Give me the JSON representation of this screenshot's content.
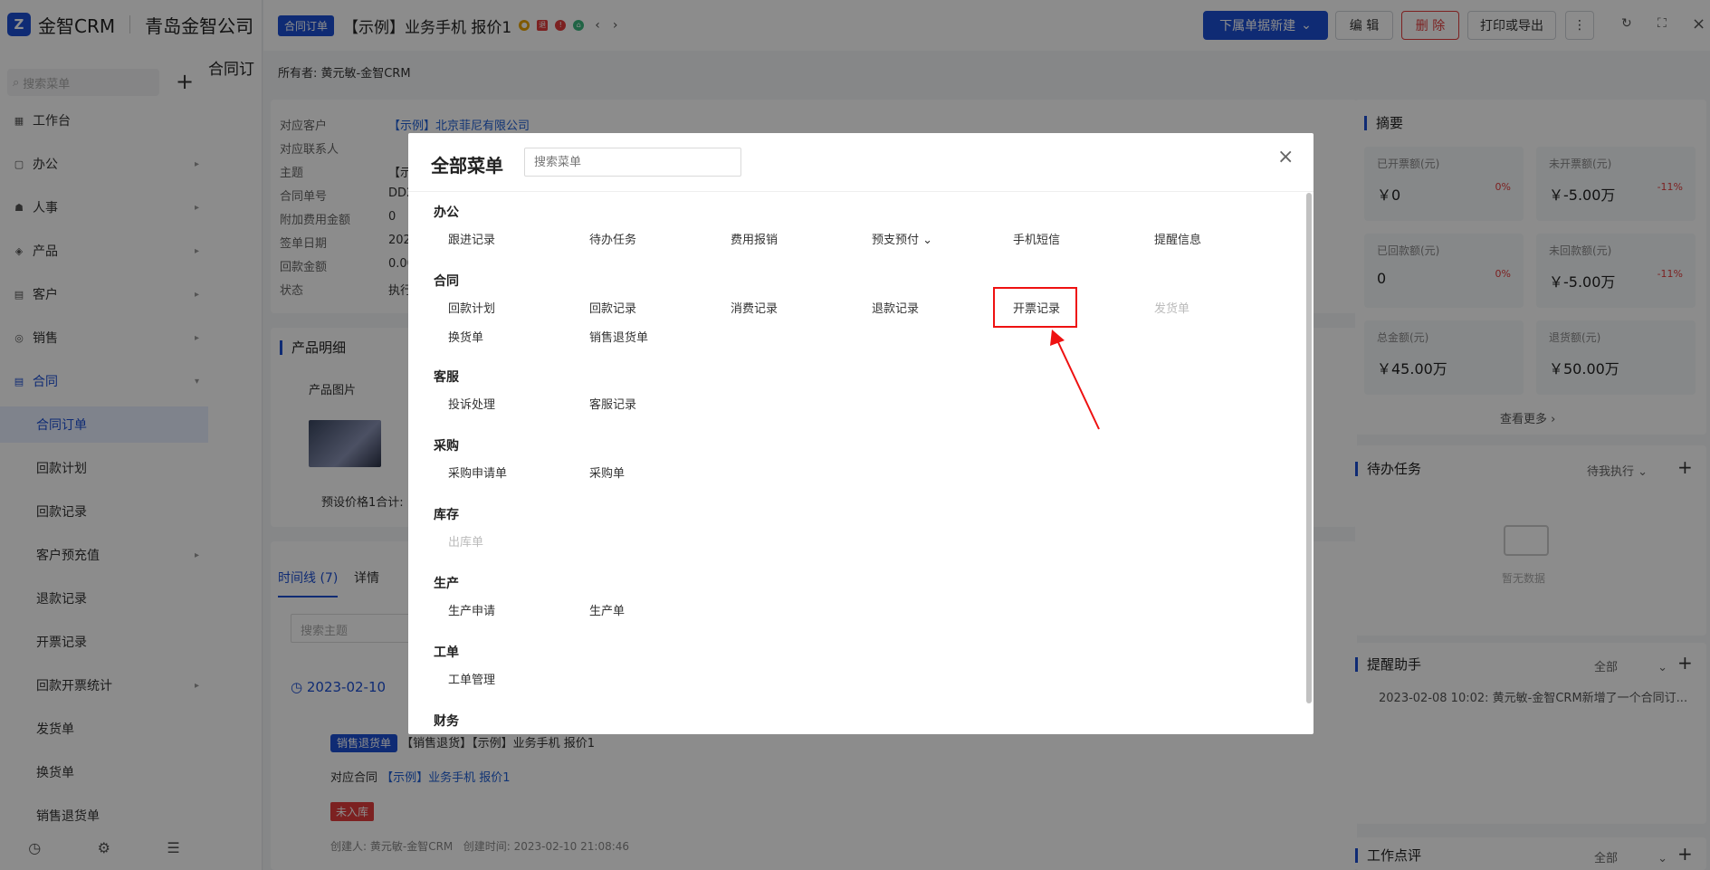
{
  "sidebar": {
    "logo_mark": "Z",
    "brand": "金智CRM",
    "company": "青岛金智公司",
    "search_placeholder": "搜索菜单",
    "plus": "+",
    "items": [
      {
        "label": "工作台",
        "icon": "▦"
      },
      {
        "label": "办公",
        "icon": "▢"
      },
      {
        "label": "人事",
        "icon": "☗"
      },
      {
        "label": "产品",
        "icon": "◈"
      },
      {
        "label": "客户",
        "icon": "▤"
      },
      {
        "label": "销售",
        "icon": "◎"
      },
      {
        "label": "合同",
        "icon": "▤"
      }
    ],
    "sub_items": [
      {
        "label": "合同订单"
      },
      {
        "label": "回款计划"
      },
      {
        "label": "回款记录"
      },
      {
        "label": "客户预充值"
      },
      {
        "label": "退款记录"
      },
      {
        "label": "开票记录"
      },
      {
        "label": "回款开票统计"
      },
      {
        "label": "发货单"
      },
      {
        "label": "换货单"
      },
      {
        "label": "销售退货单"
      }
    ],
    "bottom_icons": [
      "history-icon",
      "settings-icon",
      "menu-icon"
    ]
  },
  "page": {
    "heading": "合同订"
  },
  "drawer": {
    "tag": "合同订单",
    "title": "【示例】业务手机 报价1",
    "buttons": {
      "new_sub": "下属单据新建",
      "edit": "编 辑",
      "delete": "删 除",
      "print": "打印或导出",
      "more": "⋮"
    },
    "owner_label": "所有者:",
    "owner": "黄元敏-金智CRM",
    "fields": [
      {
        "label": "对应客户",
        "value": "【示例】北京菲尼有限公司"
      },
      {
        "label": "对应联系人",
        "value": ""
      },
      {
        "label": "主题",
        "value": "【示"
      },
      {
        "label": "合同单号",
        "value": "DD2"
      },
      {
        "label": "附加费用金额",
        "value": "0"
      },
      {
        "label": "签单日期",
        "value": "202"
      },
      {
        "label": "回款金额",
        "value": "0.00"
      },
      {
        "label": "状态",
        "value": "执行"
      }
    ],
    "product_section": "产品明细",
    "product_col": "产品图片",
    "product_note": "预设价格1合计:",
    "tabs": {
      "timeline": "时间线 (7)",
      "detail": "详情"
    },
    "search_topic": "搜索主题",
    "timeline_date": "2023-02-10",
    "timeline_tag": "销售退货单",
    "timeline_text": "【销售退货】【示例】业务手机 报价1",
    "timeline_contract_label": "对应合同",
    "timeline_contract": "【示例】业务手机 报价1",
    "timeline_status": "未入库",
    "timeline_creator": "创建人: 黄元敏-金智CRM",
    "timeline_created": "创建时间: 2023-02-10 21:08:46"
  },
  "summary": {
    "title": "摘要",
    "stats": [
      {
        "label": "已开票额(元)",
        "value": "￥0",
        "pct": "0%"
      },
      {
        "label": "未开票额(元)",
        "value": "￥-5.00万",
        "pct": "-11%"
      },
      {
        "label": "已回款额(元)",
        "value": "0",
        "pct": "0%"
      },
      {
        "label": "未回款额(元)",
        "value": "￥-5.00万",
        "pct": "-11%"
      },
      {
        "label": "总金额(元)",
        "value": "￥45.00万",
        "pct": ""
      },
      {
        "label": "退货额(元)",
        "value": "￥50.00万",
        "pct": ""
      }
    ],
    "more": "查看更多 ›"
  },
  "todo": {
    "title": "待办任务",
    "filter": "待我执行",
    "empty": "暂无数据"
  },
  "reminder": {
    "title": "提醒助手",
    "filter": "全部",
    "text": "2023-02-08 10:02: 黄元敏-金智CRM新增了一个合同订..."
  },
  "review": {
    "title": "工作点评",
    "filter": "全部"
  },
  "modal": {
    "title": "全部菜单",
    "search_placeholder": "搜索菜单",
    "close": "×",
    "groups": [
      {
        "title": "办公",
        "items": [
          "跟进记录",
          "待办任务",
          "费用报销",
          "预支预付 ⌄",
          "手机短信",
          "提醒信息"
        ]
      },
      {
        "title": "合同",
        "items": [
          "回款计划",
          "回款记录",
          "消费记录",
          "退款记录",
          "开票记录",
          "发货单",
          "换货单",
          "销售退货单"
        ]
      },
      {
        "title": "客服",
        "items": [
          "投诉处理",
          "客服记录"
        ]
      },
      {
        "title": "采购",
        "items": [
          "采购申请单",
          "采购单"
        ]
      },
      {
        "title": "库存",
        "items": [
          "出库单"
        ]
      },
      {
        "title": "生产",
        "items": [
          "生产申请",
          "生产单"
        ]
      },
      {
        "title": "工单",
        "items": [
          "工单管理"
        ]
      },
      {
        "title": "财务",
        "items": []
      }
    ]
  },
  "colors": {
    "accent": "#1c4fd3",
    "danger": "#e11111",
    "overlay": "rgba(0,0,0,0.45)"
  }
}
